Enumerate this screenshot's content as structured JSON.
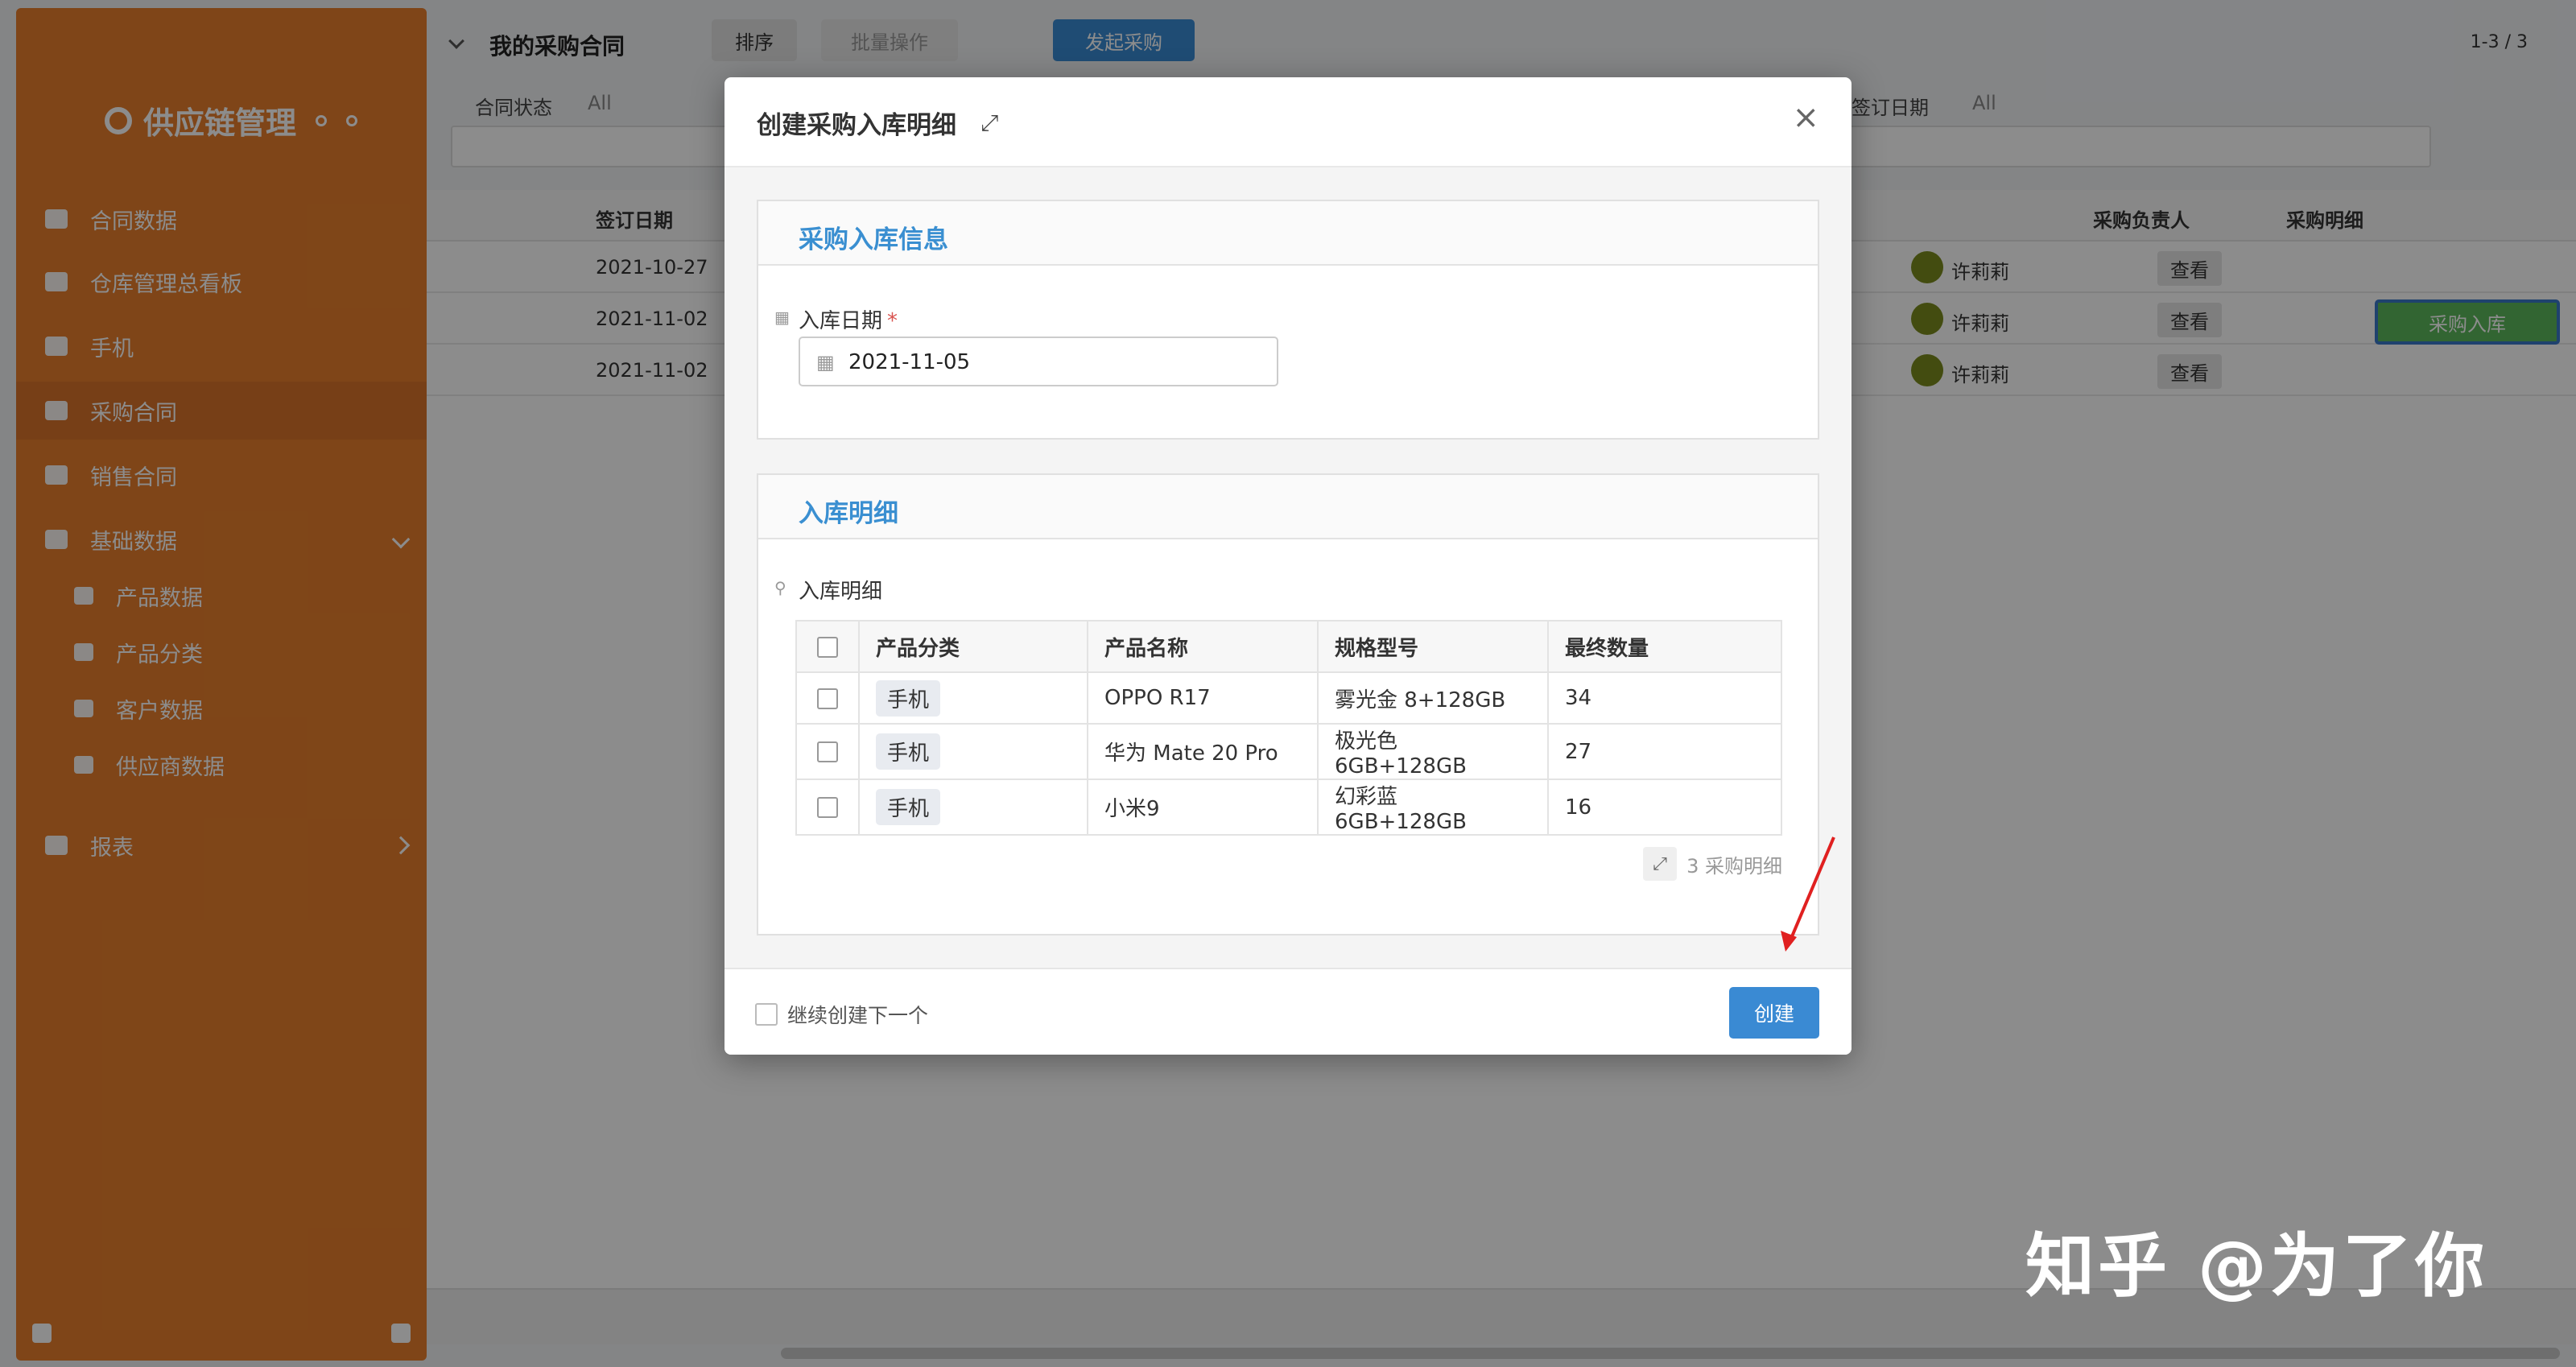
{
  "app": {
    "sidebar": {
      "logo": "供应链管理",
      "items": [
        {
          "label": "合同数据"
        },
        {
          "label": "仓库管理总看板"
        },
        {
          "label": "手机"
        },
        {
          "label": "采购合同"
        },
        {
          "label": "销售合同"
        },
        {
          "label": "基础数据"
        },
        {
          "label": "产品数据"
        },
        {
          "label": "产品分类"
        },
        {
          "label": "客户数据"
        },
        {
          "label": "供应商数据"
        },
        {
          "label": "报表"
        }
      ]
    },
    "topbar": {
      "title": "我的采购合同",
      "sort_label": "排序",
      "batch_label": "批量操作",
      "new_label": "发起采购",
      "pagination": "1-3 / 3"
    },
    "filters": {
      "status_label": "合同状态",
      "status_value": "All",
      "date_label": "签订日期",
      "date_value": "All"
    },
    "table": {
      "headers": [
        "签订日期",
        "采购负责人",
        "采购明细"
      ],
      "rows": [
        {
          "date": "2021-10-27",
          "owner": "许莉莉",
          "detail": "查看"
        },
        {
          "date": "2021-11-02",
          "owner": "许莉莉",
          "detail": "查看"
        },
        {
          "date": "2021-11-02",
          "owner": "许莉莉",
          "detail": "查看"
        }
      ],
      "row_action": "采购入库"
    }
  },
  "modal": {
    "title": "创建采购入库明细",
    "expand_icon": "expand-icon",
    "close_icon": "close-icon",
    "section1": {
      "title": "采购入库信息",
      "date_label": "入库日期",
      "required_mark": "*",
      "date_value": "2021-11-05"
    },
    "section2": {
      "title": "入库明细",
      "field_label": "入库明细",
      "columns": [
        "产品分类",
        "产品名称",
        "规格型号",
        "最终数量"
      ],
      "rows": [
        {
          "category": "手机",
          "name": "OPPO R17",
          "spec": "雾光金 8+128GB",
          "qty": "34"
        },
        {
          "category": "手机",
          "name": "华为 Mate 20 Pro",
          "spec": "极光色 6GB+128GB",
          "qty": "27"
        },
        {
          "category": "手机",
          "name": "小米9",
          "spec": "幻彩蓝 6GB+128GB",
          "qty": "16"
        }
      ],
      "count_text": "3 采购明细"
    },
    "footer": {
      "continue_label": "继续创建下一个",
      "create_label": "创建"
    }
  },
  "watermark": "知乎 @为了你",
  "colors": {
    "sidebar": "#e87f2c",
    "accent": "#3a8ad3",
    "section_title": "#3a8fd1",
    "required": "#d9534f",
    "annotation_arrow": "#e02020"
  }
}
